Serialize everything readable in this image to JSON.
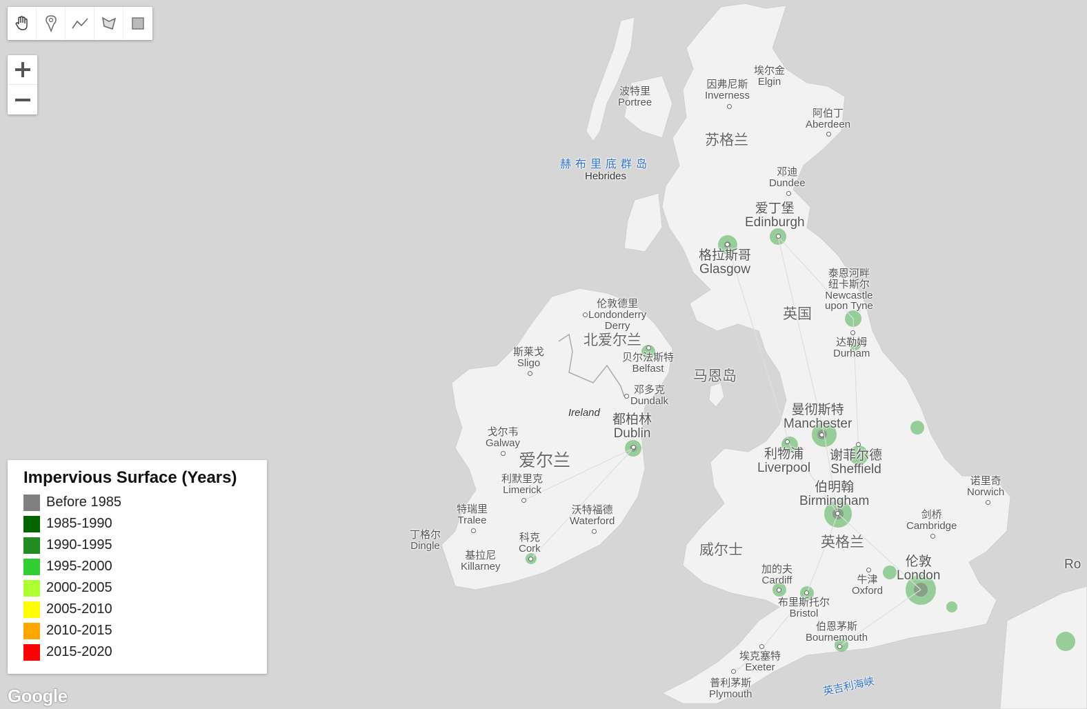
{
  "toolbar": {
    "tools": [
      "hand-icon",
      "marker-icon",
      "polyline-icon",
      "polygon-icon",
      "rectangle-icon"
    ]
  },
  "zoom": {
    "in_label": "+",
    "out_label": "−"
  },
  "legend": {
    "title": "Impervious Surface (Years)",
    "items": [
      {
        "label": "Before 1985",
        "color": "#808080"
      },
      {
        "label": "1985-1990",
        "color": "#006400"
      },
      {
        "label": "1990-1995",
        "color": "#228B22"
      },
      {
        "label": "1995-2000",
        "color": "#32CD32"
      },
      {
        "label": "2000-2005",
        "color": "#ADFF2F"
      },
      {
        "label": "2005-2010",
        "color": "#FFFF00"
      },
      {
        "label": "2010-2015",
        "color": "#FFA500"
      },
      {
        "label": "2015-2020",
        "color": "#FF0000"
      }
    ]
  },
  "map_labels": {
    "elgin": {
      "zh": "埃尔金",
      "en": "Elgin"
    },
    "inverness": {
      "zh": "因弗尼斯",
      "en": "Inverness"
    },
    "portree": {
      "zh": "波特里",
      "en": "Portree"
    },
    "aberdeen": {
      "zh": "阿伯丁",
      "en": "Aberdeen"
    },
    "scotland": {
      "zh": "苏格兰"
    },
    "hebrides": {
      "zh": "赫布里底群岛",
      "en": "Hebrides"
    },
    "dundee": {
      "zh": "邓迪",
      "en": "Dundee"
    },
    "edinburgh": {
      "zh": "爱丁堡",
      "en": "Edinburgh"
    },
    "glasgow": {
      "zh": "格拉斯哥",
      "en": "Glasgow"
    },
    "newcastle": {
      "zh": "泰恩河畔\n纽卡斯尔",
      "en": "Newcastle\nupon Tyne"
    },
    "uk": {
      "zh": "英国"
    },
    "durham": {
      "zh": "达勒姆",
      "en": "Durham"
    },
    "londonderry": {
      "zh": "伦敦德里",
      "en": "Londonderry\nDerry"
    },
    "northern_ireland": {
      "zh": "北爱尔兰"
    },
    "belfast": {
      "zh": "贝尔法斯特",
      "en": "Belfast"
    },
    "sligo": {
      "zh": "斯莱戈",
      "en": "Sligo"
    },
    "isle_of_man": {
      "zh": "马恩岛"
    },
    "dundalk": {
      "zh": "邓多克",
      "en": "Dundalk"
    },
    "ireland_en": {
      "en": "Ireland"
    },
    "dublin": {
      "zh": "都柏林",
      "en": "Dublin"
    },
    "galway": {
      "zh": "戈尔韦",
      "en": "Galway"
    },
    "ireland": {
      "zh": "爱尔兰"
    },
    "manchester": {
      "zh": "曼彻斯特",
      "en": "Manchester"
    },
    "liverpool": {
      "zh": "利物浦",
      "en": "Liverpool"
    },
    "sheffield": {
      "zh": "谢菲尔德",
      "en": "Sheffield"
    },
    "limerick": {
      "zh": "利默里克",
      "en": "Limerick"
    },
    "birmingham": {
      "zh": "伯明翰",
      "en": "Birmingham"
    },
    "norwich": {
      "zh": "诺里奇",
      "en": "Norwich"
    },
    "tralee": {
      "zh": "特瑞里",
      "en": "Tralee"
    },
    "waterford": {
      "zh": "沃特福德",
      "en": "Waterford"
    },
    "cambridge": {
      "zh": "剑桥",
      "en": "Cambridge"
    },
    "dingle": {
      "zh": "丁格尔",
      "en": "Dingle"
    },
    "cork": {
      "zh": "科克",
      "en": "Cork"
    },
    "wales": {
      "zh": "威尔士"
    },
    "england": {
      "zh": "英格兰"
    },
    "killarney": {
      "zh": "基拉尼",
      "en": "Killarney"
    },
    "london": {
      "zh": "伦敦",
      "en": "London"
    },
    "cardiff": {
      "zh": "加的夫",
      "en": "Cardiff"
    },
    "oxford": {
      "zh": "牛津",
      "en": "Oxford"
    },
    "bristol": {
      "zh": "布里斯托尔",
      "en": "Bristol"
    },
    "bournemouth": {
      "zh": "伯恩茅斯",
      "en": "Bournemouth"
    },
    "exeter": {
      "zh": "埃克塞特",
      "en": "Exeter"
    },
    "plymouth": {
      "zh": "普利茅斯",
      "en": "Plymouth"
    },
    "channel": {
      "zh": "英吉利海峡"
    },
    "ro": {
      "en": "Ro"
    }
  },
  "google_logo": "Google"
}
